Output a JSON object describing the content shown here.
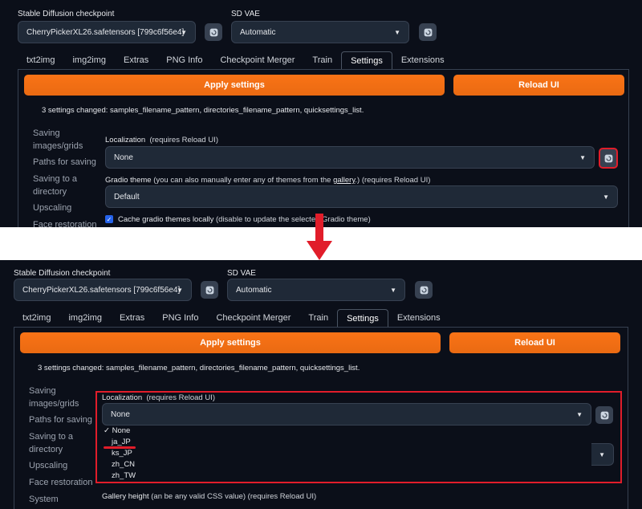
{
  "header": {
    "checkpoint_label": "Stable Diffusion checkpoint",
    "checkpoint_value": "CherryPickerXL26.safetensors [799c6f56e4]",
    "vae_label": "SD VAE",
    "vae_value": "Automatic"
  },
  "tabs": [
    "txt2img",
    "img2img",
    "Extras",
    "PNG Info",
    "Checkpoint Merger",
    "Train",
    "Settings",
    "Extensions"
  ],
  "active_tab": "Settings",
  "buttons": {
    "apply": "Apply settings",
    "reload": "Reload UI"
  },
  "changed_text": "3 settings changed: samples_filename_pattern, directories_filename_pattern, quicksettings_list.",
  "sidebar_top": [
    "Saving images/grids",
    "Paths for saving",
    "Saving to a directory",
    "Upscaling",
    "Face restoration"
  ],
  "sidebar_bottom": [
    "Saving images/grids",
    "Paths for saving",
    "Saving to a directory",
    "Upscaling",
    "Face restoration",
    "System"
  ],
  "localization": {
    "label": "Localization",
    "hint": "(requires Reload UI)",
    "value": "None"
  },
  "gradio_theme": {
    "label": "Gradio theme",
    "hint_pre": "(you can also manually enter any of themes from the",
    "link": "gallery",
    "hint_post": ".) (requires Reload UI)",
    "value": "Default"
  },
  "cache_theme": {
    "label": "Cache gradio themes locally",
    "hint": "(disable to update the selected Gradio theme)"
  },
  "gallery_height": {
    "label": "Gallery height",
    "hint": "(an be any valid CSS value) (requires Reload UI)"
  },
  "dropdown_options": [
    "None",
    "ja_JP",
    "ks_JP",
    "zh_CN",
    "zh_TW"
  ],
  "selected_option": "None",
  "colors": {
    "accent": "#f97316",
    "highlight": "#e11d2a",
    "bg": "#0b0f19",
    "field": "#1f2937"
  }
}
